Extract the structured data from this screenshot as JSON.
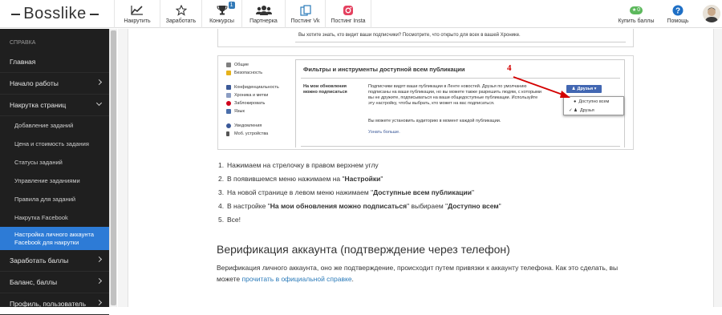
{
  "brand": {
    "logo_text": "Bosslike"
  },
  "nav": [
    {
      "label": "Накрутить",
      "icon": "chart-line-icon"
    },
    {
      "label": "Заработать",
      "icon": "star-icon"
    },
    {
      "label": "Конкурсы",
      "icon": "trophy-icon",
      "badge": "1"
    },
    {
      "label": "Партнерка",
      "icon": "users-icon"
    },
    {
      "label": "Постинг Vk",
      "icon": "copy-icon"
    },
    {
      "label": "Постинг Insta",
      "icon": "instagram-icon"
    }
  ],
  "nav_right": {
    "buy_points": {
      "label": "Купить баллы",
      "badge": "0"
    },
    "help": {
      "label": "Помощь"
    }
  },
  "sidebar": {
    "heading": "СПРАВКА",
    "items": [
      {
        "label": "Главная"
      },
      {
        "label": "Начало работы"
      },
      {
        "label": "Накрутка страниц"
      }
    ],
    "subitems": [
      {
        "label": "Добавление заданий"
      },
      {
        "label": "Цена и стоимость задания"
      },
      {
        "label": "Статусы заданий"
      },
      {
        "label": "Управление заданиями"
      },
      {
        "label": "Правила для заданий"
      },
      {
        "label": "Накрутка Facebook"
      },
      {
        "label_line1": "Настройка личного аккаунта",
        "label_line2": "Facebook для накрутки"
      }
    ],
    "bottom_items": [
      {
        "label": "Заработать баллы"
      },
      {
        "label": "Баланс, баллы"
      },
      {
        "label": "Профиль, пользователь"
      }
    ]
  },
  "screenshot_top": {
    "text": "Вы хотите знать, кто видит ваши подписчики? Посмотрите, что открыто для всех в вашей Хронике."
  },
  "fb": {
    "left_menu": [
      "Общие",
      "Безопасность",
      "Конфиденциальность",
      "Хроника и метки",
      "Заблокировать",
      "Язык",
      "Уведомления",
      "Моб. устройства"
    ],
    "title": "Фильтры и инструменты доступной всем публикации",
    "row_label": "На мои обновления можно подписаться",
    "desc": "Подписчики видят ваши публикации в Ленте новостей. Друзья по умолчанию подписаны на ваши публикации, но вы можете также разрешить людям, с которыми вы не дружите, подписываться на ваши общедоступные публикации. Используйте эту настройку, чтобы выбрать, кто может на вас подписаться.",
    "desc2": "Вы можете установить аудиторию в момент каждой публикации.",
    "link": "Узнать больше.",
    "button": "Друзья",
    "menu": [
      "Доступно всем",
      "Друзья"
    ],
    "annotation": "4"
  },
  "steps": [
    {
      "n": "1.",
      "pre": "Нажимаем на стрелочку в правом верхнем углу",
      "bold": "",
      "mid": "",
      "bold2": "",
      "post": ""
    },
    {
      "n": "2.",
      "pre": "В появившемся меню нажимаем на \"",
      "bold": "Настройки",
      "mid": "\"",
      "bold2": "",
      "post": ""
    },
    {
      "n": "3.",
      "pre": "На новой странице в левом меню нажимаем \"",
      "bold": "Доступные всем публикации",
      "mid": "\"",
      "bold2": "",
      "post": ""
    },
    {
      "n": "4.",
      "pre": "В настройке \"",
      "bold": "На мои обновления можно подписаться",
      "mid": "\" выбираем \"",
      "bold2": "Доступно всем",
      "post": "\""
    },
    {
      "n": "5.",
      "pre": "Все!",
      "bold": "",
      "mid": "",
      "bold2": "",
      "post": ""
    }
  ],
  "section": {
    "heading": "Верификация аккаунта (подтверждение через телефон)",
    "para": "Верификация личного аккаунта, оно же подтверждение, происходит путем привязки к аккаунту телефона. Как это сделать, вы можете ",
    "link": "прочитать в официальной справке",
    "after_link": "."
  },
  "colors": {
    "sidebar_bg": "#1f1f1f",
    "sidebar_active": "#2d7bd6",
    "accent": "#337ab7",
    "link": "#2a7ab9",
    "fb_blue": "#4267b2",
    "annotation_red": "#d40000"
  }
}
